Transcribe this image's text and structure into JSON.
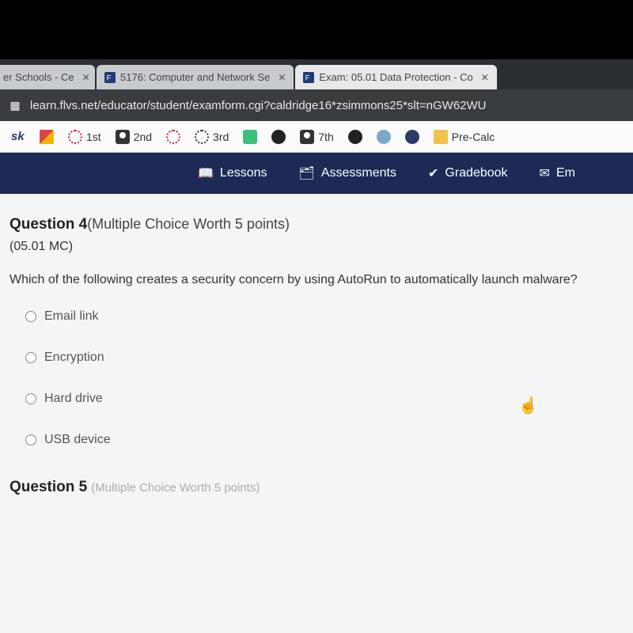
{
  "tabs": [
    {
      "title": "er Schools - Ce"
    },
    {
      "title": "5176: Computer and Network Se"
    },
    {
      "title": "Exam: 05.01 Data Protection - Co"
    }
  ],
  "url": "learn.flvs.net/educator/student/examform.cgi?caldridge16*zsimmons25*slt=nGW62WU",
  "bookmarks": {
    "b1": "1st",
    "b2": "2nd",
    "b3": "3rd",
    "b4": "7th",
    "b5": "Pre-Calc"
  },
  "nav": {
    "lessons": "Lessons",
    "assessments": "Assessments",
    "gradebook": "Gradebook",
    "email": "Em"
  },
  "question4": {
    "label": "Question 4",
    "meta": "(Multiple Choice Worth 5 points)",
    "code": "(05.01 MC)",
    "text": "Which of the following creates a security concern by using AutoRun to automatically launch malware?",
    "options": {
      "a": "Email link",
      "b": "Encryption",
      "c": "Hard drive",
      "d": "USB device"
    }
  },
  "question5": {
    "label": "Question 5",
    "meta": "(Multiple Choice Worth 5 points)"
  }
}
